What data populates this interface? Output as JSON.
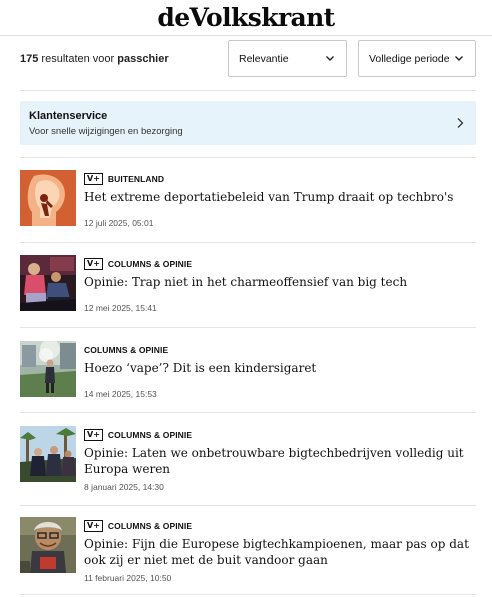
{
  "brand": {
    "logo": "deVolkskrant"
  },
  "search": {
    "count": "175",
    "results_text": "resultaten voor",
    "query": "passchier"
  },
  "filters": {
    "sort": {
      "value": "Relevantie",
      "icon": "chevron-down-icon"
    },
    "period": {
      "value": "Volledige periode",
      "icon": "chevron-down-icon"
    }
  },
  "service": {
    "title": "Klantenservice",
    "subtitle": "Voor snelle wijzigingen en bezorging",
    "icon": "chevron-right-icon"
  },
  "plus_badge": "V+",
  "articles": [
    {
      "plus": true,
      "category": "BUITENLAND",
      "headline": "Het extreme deportatiebeleid van Trump draait op techbro's",
      "date": "12 juli 2025, 05:01"
    },
    {
      "plus": true,
      "category": "COLUMNS & OPINIE",
      "headline": "Opinie: Trap niet in het charmeoffensief van big tech",
      "date": "12 mei 2025, 15:41"
    },
    {
      "plus": false,
      "category": "COLUMNS & OPINIE",
      "headline": "Hoezo ‘vape’? Dit is een kindersigaret",
      "date": "14 mei 2025, 15:53"
    },
    {
      "plus": true,
      "category": "COLUMNS & OPINIE",
      "headline": "Opinie: Laten we onbetrouwbare bigtechbedrijven volledig uit Europa weren",
      "date": "8 januari 2025, 14:30"
    },
    {
      "plus": true,
      "category": "COLUMNS & OPINIE",
      "headline": "Opinie: Fijn die Europese bigtechkampioenen, maar pas op dat ook zij er niet met de buit vandoor gaan",
      "date": "11 februari 2025, 10:50"
    }
  ]
}
